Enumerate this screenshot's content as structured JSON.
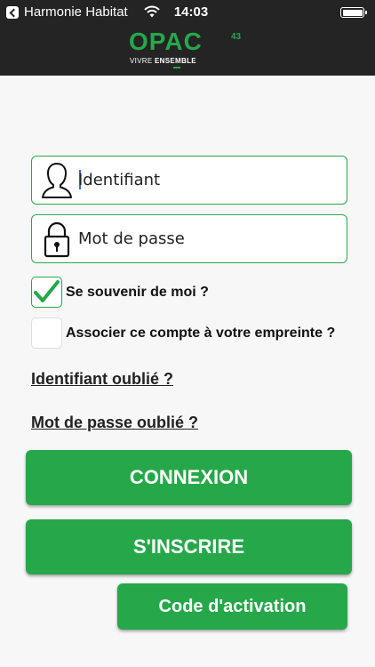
{
  "status_bar": {
    "carrier": "Harmonie Habitat",
    "time": "14:03"
  },
  "header": {
    "logo_text": "OPAC",
    "logo_number": "43",
    "tagline_light": "VIVRE",
    "tagline_bold": "ENSEMBLE"
  },
  "login_form": {
    "username_placeholder": "Identifiant",
    "password_placeholder": "Mot de passe",
    "remember_me": {
      "label": "Se souvenir de moi ?",
      "checked": true
    },
    "fingerprint": {
      "label": "Associer ce compte à votre empreinte ?",
      "checked": false
    },
    "forgot_username_link": "Identifiant oublié ?",
    "forgot_password_link": "Mot de passe oublié ?",
    "login_button": "CONNEXION",
    "register_button": "S'INSCRIRE",
    "activation_button": "Code d'activation"
  },
  "colors": {
    "brand_green": "#26a84a",
    "header_background": "#242424",
    "page_background": "#f7f7f7",
    "caret": "#3366ff"
  },
  "icons": {
    "username": "user-icon",
    "password": "lock-icon",
    "checkmark": "checkmark-icon"
  }
}
